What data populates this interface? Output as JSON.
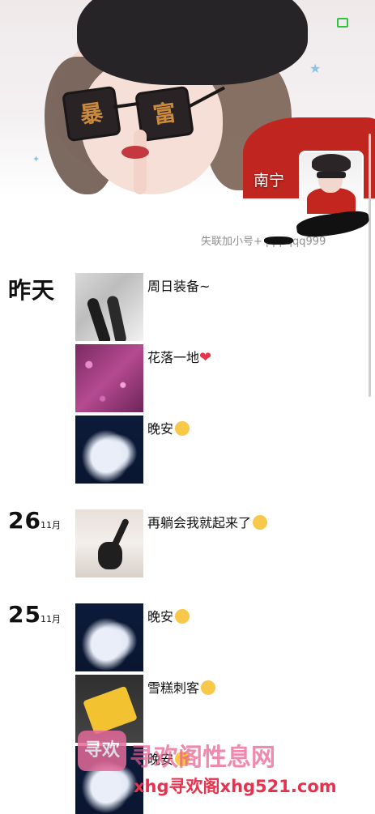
{
  "cover": {
    "glasses_left": "暴",
    "glasses_right": "富"
  },
  "status": {
    "battery_color": "#2ec43c"
  },
  "profile": {
    "username": "南宁",
    "signature": "失联加小号+ pppqqq999"
  },
  "feed": [
    {
      "day": "昨天",
      "month": "",
      "posts": [
        {
          "caption": "周日装备~",
          "emoji": "",
          "thumb": "legs"
        },
        {
          "caption": "花落一地",
          "emoji": "heart",
          "thumb": "glitter"
        },
        {
          "caption": "晚安",
          "emoji": "sleepy",
          "thumb": "night"
        }
      ]
    },
    {
      "day": "26",
      "month": "11月",
      "posts": [
        {
          "caption": "再躺会我就起来了",
          "emoji": "wink",
          "thumb": "bed"
        }
      ]
    },
    {
      "day": "25",
      "month": "11月",
      "posts": [
        {
          "caption": "晚安",
          "emoji": "sleepy",
          "thumb": "night"
        },
        {
          "caption": "雪糕刺客",
          "emoji": "laugh",
          "thumb": "cake"
        },
        {
          "caption": "晚安",
          "emoji": "sleepy",
          "thumb": "night"
        }
      ]
    }
  ],
  "watermark": {
    "logo": "寻欢",
    "line1": "寻欢阁性息网",
    "line2": "xhg寻欢阁xhg521.com"
  }
}
